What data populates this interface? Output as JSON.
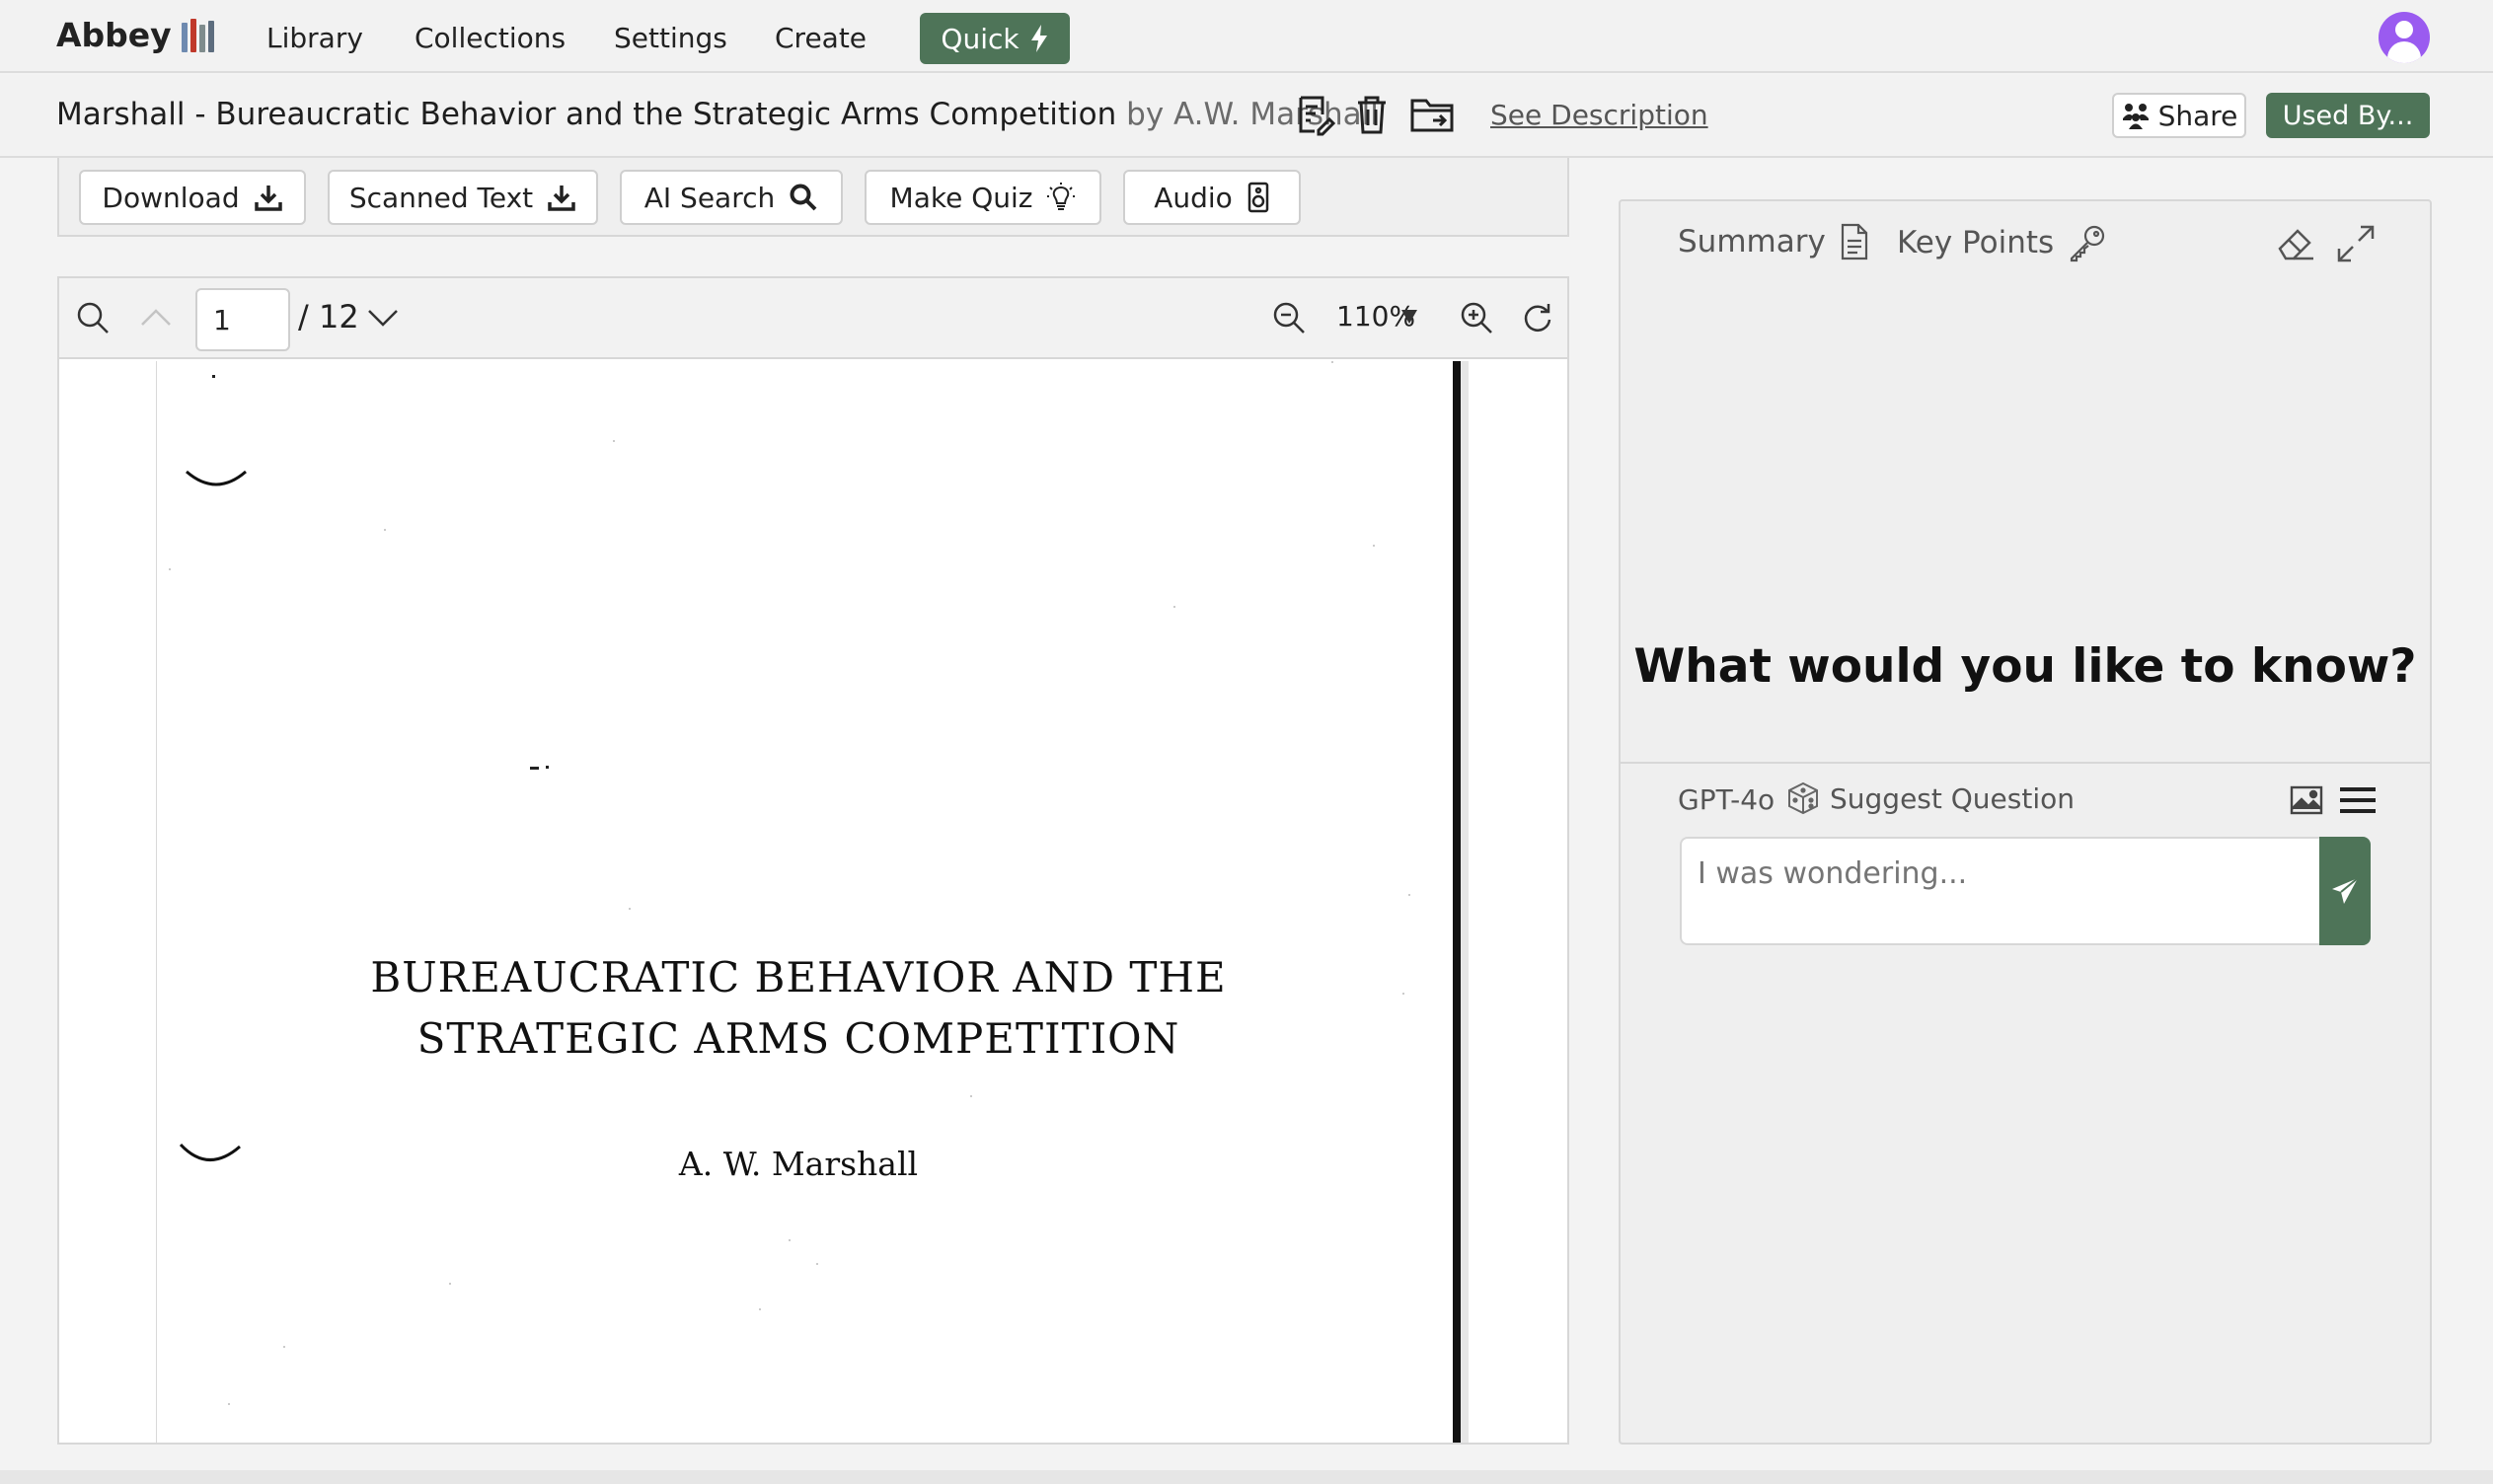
{
  "nav": {
    "brand": "Abbey",
    "links": [
      "Library",
      "Collections",
      "Settings",
      "Create"
    ],
    "quick_label": "Quick"
  },
  "doc": {
    "title": "Marshall - Bureaucratic Behavior and the Strategic Arms Competition",
    "author": "by A.W. Marshall",
    "see_description": "See Description",
    "share_label": "Share",
    "used_by_label": "Used By..."
  },
  "actions": {
    "download": "Download",
    "scanned_text": "Scanned Text",
    "ai_search": "AI Search",
    "make_quiz": "Make Quiz",
    "audio": "Audio"
  },
  "viewer": {
    "page_number": "1",
    "page_total": "/ 12",
    "zoom": "110%",
    "scan_title_line1": "BUREAUCRATIC BEHAVIOR AND THE",
    "scan_title_line2": "STRATEGIC ARMS COMPETITION",
    "scan_author": "A. W. Marshall"
  },
  "ai_panel": {
    "tab_summary": "Summary",
    "tab_key_points": "Key Points",
    "prompt": "What would you like to know?",
    "model": "GPT-4o",
    "suggest_label": "Suggest Question",
    "input_placeholder": "I was wondering..."
  },
  "colors": {
    "accent_green": "#4e7458",
    "avatar_purple": "#9a5bf0"
  },
  "icons": {
    "quick": "lightning-icon",
    "share": "share-people-icon",
    "download": "download-icon",
    "search": "magnifier-icon",
    "quiz": "lightbulb-icon",
    "audio": "speaker-icon",
    "send": "paper-plane-icon"
  }
}
